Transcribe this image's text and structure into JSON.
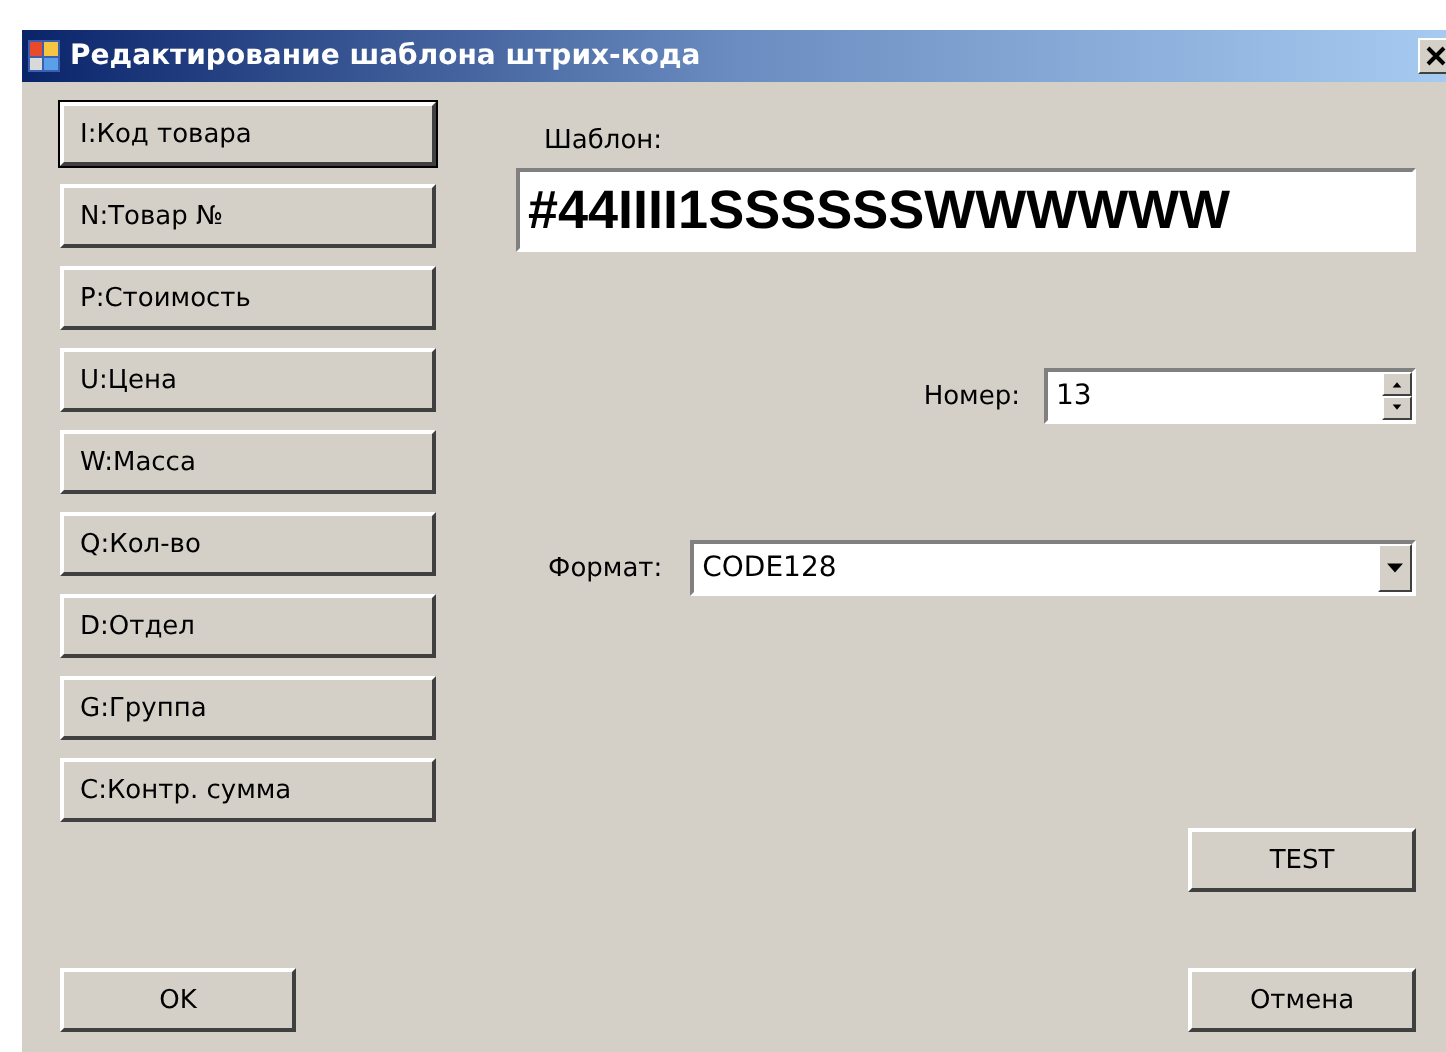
{
  "window": {
    "title": "Редактирование шаблона штрих-кода"
  },
  "field_buttons": [
    {
      "label": "I:Код товара",
      "selected": true
    },
    {
      "label": "N:Товар №",
      "selected": false
    },
    {
      "label": "P:Стоимость",
      "selected": false
    },
    {
      "label": "U:Цена",
      "selected": false
    },
    {
      "label": "W:Масса",
      "selected": false
    },
    {
      "label": "Q:Кол-во",
      "selected": false
    },
    {
      "label": "D:Отдел",
      "selected": false
    },
    {
      "label": "G:Группа",
      "selected": false
    },
    {
      "label": "C:Контр. сумма",
      "selected": false
    }
  ],
  "template": {
    "label": "Шаблон:",
    "value": "#44IIII1SSSSSSWWWWWW"
  },
  "number": {
    "label": "Номер:",
    "value": "13"
  },
  "format": {
    "label": "Формат:",
    "value": "CODE128"
  },
  "buttons": {
    "test": "TEST",
    "ok": "OK",
    "cancel": "Отмена"
  }
}
